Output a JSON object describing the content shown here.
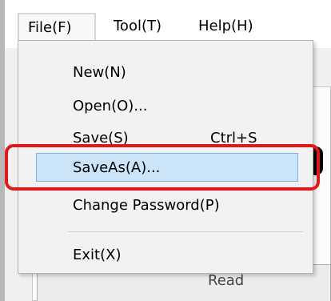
{
  "menubar": {
    "file": "File(F)",
    "tool": "Tool(T)",
    "help": "Help(H)"
  },
  "file_menu": {
    "items": [
      {
        "label": "New(N)",
        "shortcut": ""
      },
      {
        "label": "Open(O)...",
        "shortcut": ""
      },
      {
        "label": "Save(S)",
        "shortcut": "Ctrl+S"
      },
      {
        "label": "SaveAs(A)...",
        "shortcut": "",
        "highlighted": true
      },
      {
        "label": "Change Password(P)",
        "shortcut": ""
      },
      {
        "label": "Exit(X)",
        "shortcut": ""
      }
    ]
  },
  "background": {
    "read_label": "Read"
  },
  "colors": {
    "highlight": "#cce4f7",
    "highlight_border": "#7ab4e4",
    "callout_outline": "#e8141b"
  }
}
